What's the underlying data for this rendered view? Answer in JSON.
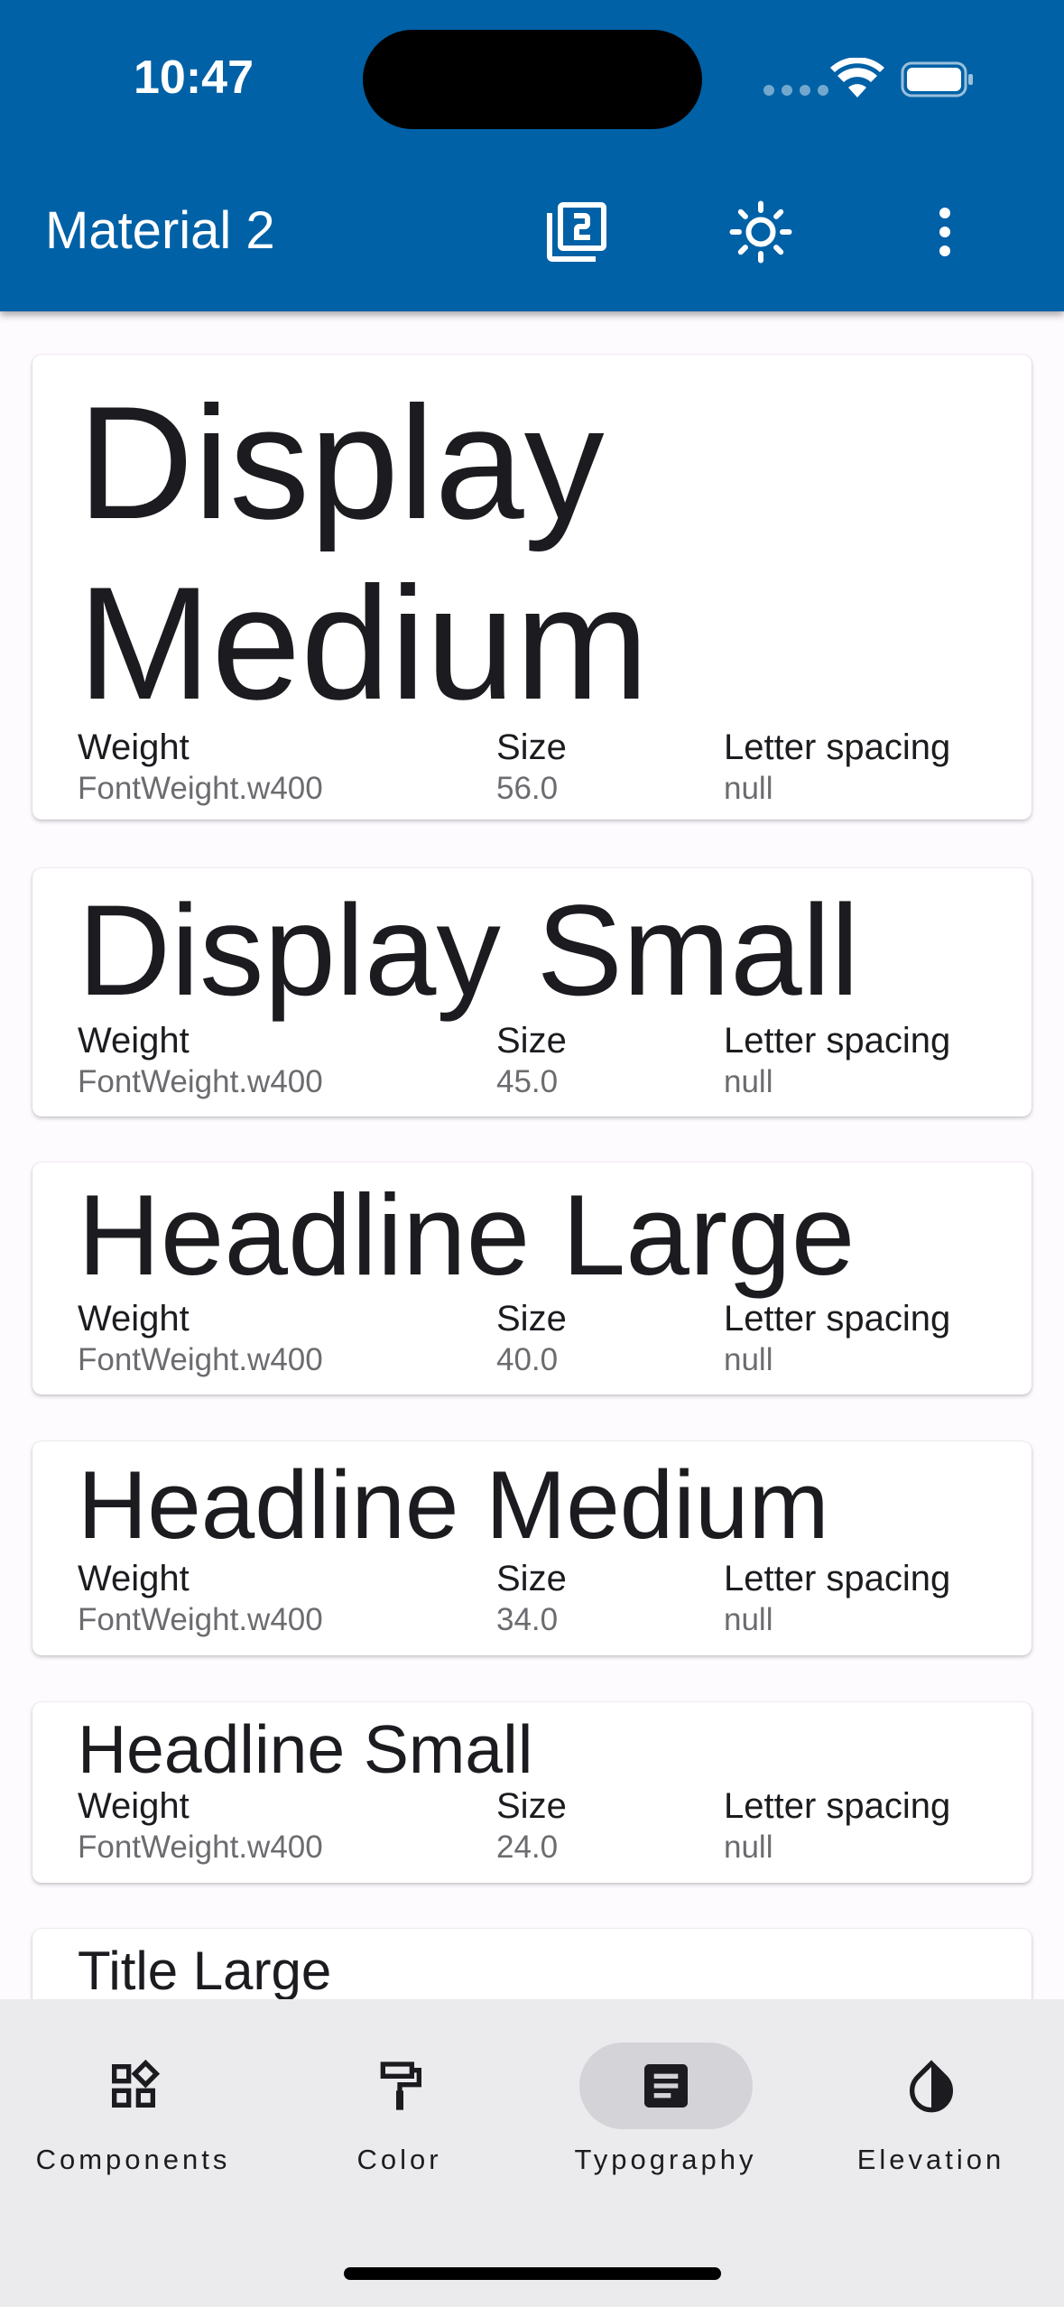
{
  "status_bar": {
    "time": "10:47"
  },
  "app_bar": {
    "title": "Material 2",
    "actions": [
      "material-version-icon",
      "brightness-icon",
      "more-vert-icon"
    ]
  },
  "field_labels": {
    "weight": "Weight",
    "size": "Size",
    "letter_spacing": "Letter spacing"
  },
  "styles": [
    {
      "name": "Display Medium",
      "weight": "FontWeight.w400",
      "size": "56.0",
      "letter_spacing": "null"
    },
    {
      "name": "Display Small",
      "weight": "FontWeight.w400",
      "size": "45.0",
      "letter_spacing": "null"
    },
    {
      "name": "Headline Large",
      "weight": "FontWeight.w400",
      "size": "40.0",
      "letter_spacing": "null"
    },
    {
      "name": "Headline Medium",
      "weight": "FontWeight.w400",
      "size": "34.0",
      "letter_spacing": "null"
    },
    {
      "name": "Headline Small",
      "weight": "FontWeight.w400",
      "size": "24.0",
      "letter_spacing": "null"
    },
    {
      "name": "Title Large"
    }
  ],
  "bottom_nav": {
    "items": [
      {
        "label": "Components",
        "icon": "widgets-icon"
      },
      {
        "label": "Color",
        "icon": "format-paint-icon"
      },
      {
        "label": "Typography",
        "icon": "article-icon",
        "selected": true
      },
      {
        "label": "Elevation",
        "icon": "opacity-icon"
      }
    ]
  },
  "colors": {
    "app_bar": "#0061a6",
    "nav_bg": "#ebebed",
    "nav_indicator": "#d4d3d7"
  }
}
